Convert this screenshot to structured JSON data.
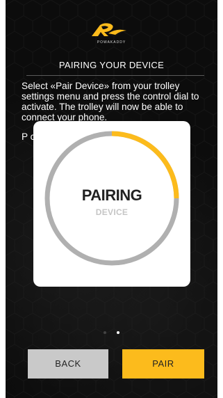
{
  "header": {
    "brand": "POWAKADDY",
    "logo_icon": "powakaddy-logo-icon",
    "title": "PAIRING YOUR DEVICE"
  },
  "instructions": {
    "paragraph_1": "Select «Pair Device» from your trolley settings menu and press the control dial to activate. The trolley will now be able to connect your phone.",
    "paragraph_2": "P c"
  },
  "modal": {
    "status_title": "PAIRING",
    "status_subtitle": "DEVICE",
    "progress": 0.25
  },
  "pager": {
    "total": 2,
    "active_index": 1
  },
  "buttons": {
    "back_label": "BACK",
    "pair_label": "PAIR"
  },
  "colors": {
    "accent": "#fcbb1c",
    "background": "#0c0c0c",
    "ring_track": "#b0b0b0",
    "back_button": "#c9c9c9"
  }
}
